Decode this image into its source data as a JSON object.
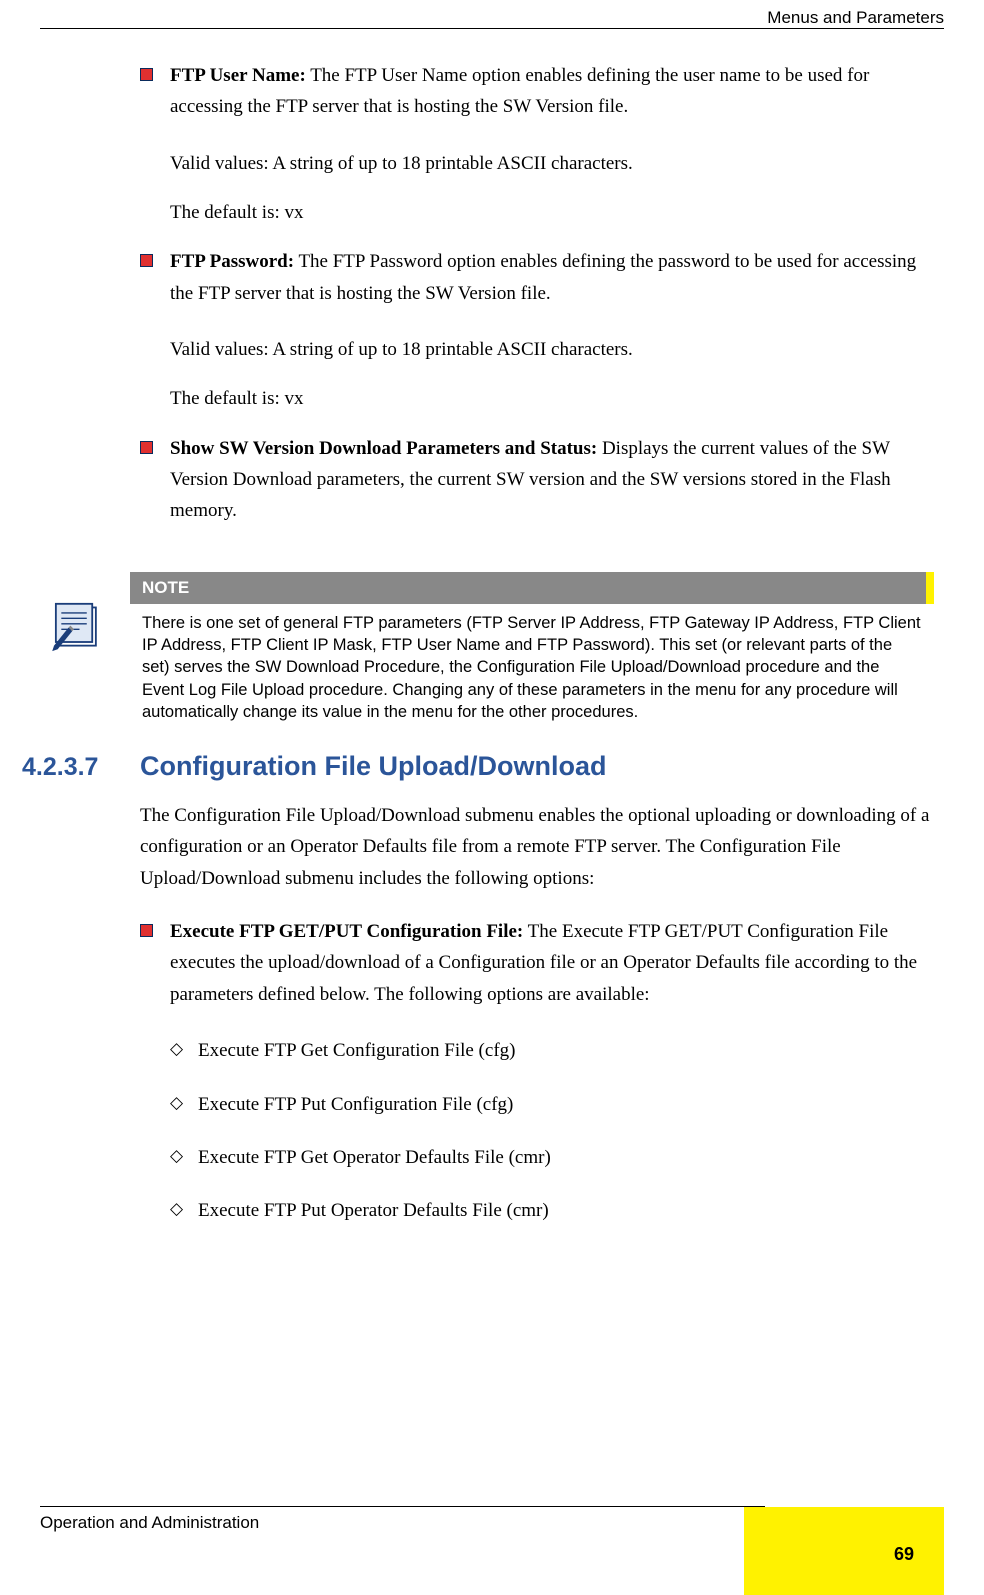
{
  "header": {
    "chapter": "Menus and Parameters"
  },
  "bullets": {
    "item1_title": "FTP User Name:",
    "item1_text": " The FTP User Name option enables defining the user name to be used for accessing the FTP server that is hosting the SW Version file.",
    "item1_valid": "Valid values: A string of up to 18 printable ASCII characters.",
    "item1_default": "The default is: vx",
    "item2_title": "FTP Password:",
    "item2_text": " The FTP Password option enables defining the password to be used for accessing the FTP server that is hosting the SW Version file.",
    "item2_valid": "Valid values: A string of up to 18 printable ASCII characters.",
    "item2_default": "The default is: vx",
    "item3_title": "Show SW Version Download Parameters and Status:",
    "item3_text": " Displays the current values of the SW Version Download parameters, the current SW version and the SW versions stored in the Flash memory."
  },
  "note": {
    "label": "NOTE",
    "body": "There is one set of general FTP parameters (FTP Server IP Address, FTP Gateway IP Address, FTP Client IP Address, FTP Client IP Mask, FTP User Name and FTP Password). This set (or relevant parts of the set) serves the SW Download Procedure, the Configuration File Upload/Download procedure and the Event Log File Upload procedure. Changing any of these parameters in the menu for any procedure will automatically change its value in the menu for the other procedures."
  },
  "section": {
    "number": "4.2.3.7",
    "title": "Configuration File Upload/Download",
    "intro": "The Configuration File Upload/Download submenu enables the optional uploading or downloading of a configuration or an Operator Defaults file from a remote FTP server. The Configuration File Upload/Download submenu includes the following options:",
    "exec_title": "Execute FTP GET/PUT Configuration File:",
    "exec_text": " The Execute FTP GET/PUT Configuration File executes the upload/download of a Configuration file or an Operator Defaults file according to the parameters defined below. The following options are available:",
    "opt1": "Execute FTP Get Configuration File (cfg)",
    "opt2": "Execute FTP Put Configuration File (cfg)",
    "opt3": "Execute FTP Get Operator Defaults File (cmr)",
    "opt4": "Execute FTP Put Operator Defaults File (cmr)"
  },
  "footer": {
    "text": "Operation and Administration",
    "page": "69"
  }
}
